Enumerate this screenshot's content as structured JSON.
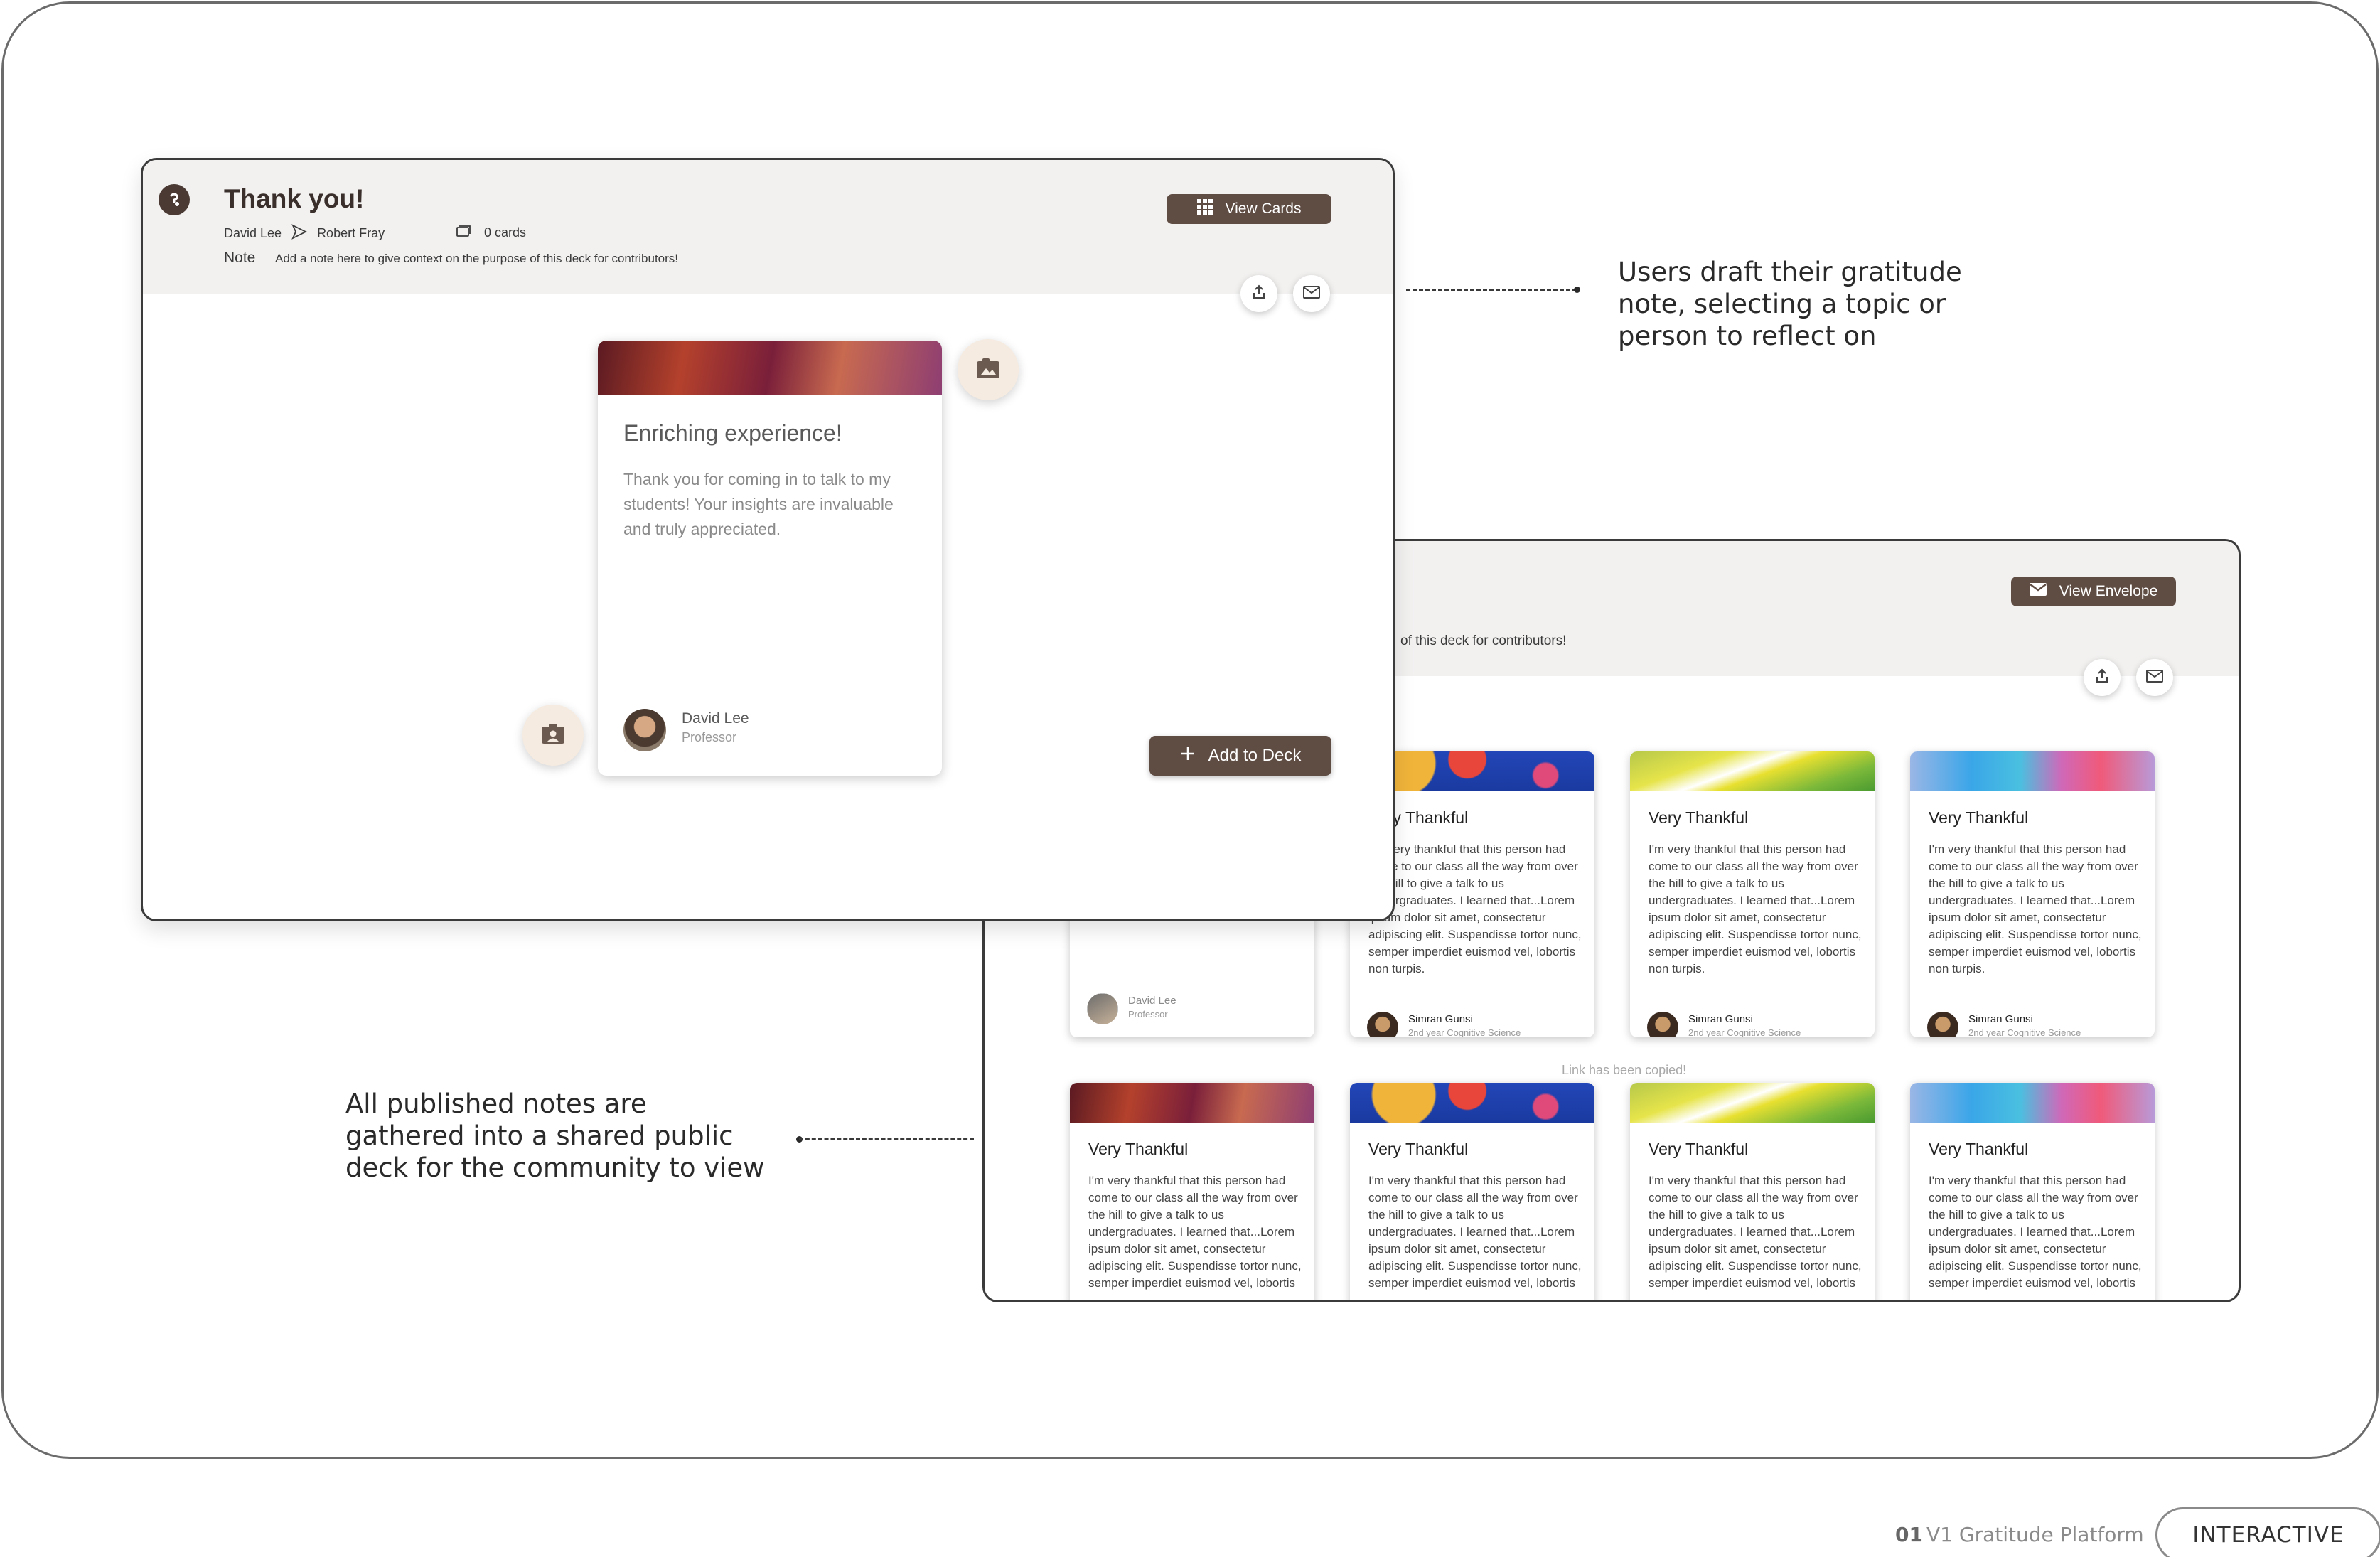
{
  "annotations": {
    "draft": "Users draft their gratitude note, selecting a topic or person to reflect on",
    "deck": "All published notes are gathered into a shared public deck for the community to view"
  },
  "footer": {
    "number": "01",
    "label": "V1 Gratitude Platform",
    "badge": "INTERACTIVE"
  },
  "draft_window": {
    "title": "Thank you!",
    "from": "David Lee",
    "to": "Robert Fray",
    "card_count": "0 cards",
    "note_label": "Note",
    "note_text": "Add a note here to give context on the purpose of this deck for contributors!",
    "view_cards_label": "View Cards",
    "add_to_deck_label": "Add to Deck",
    "card": {
      "title": "Enriching experience!",
      "body": "Thank you for coming in to talk to my students! Your insights are invaluable and truly appreciated.",
      "author": "David Lee",
      "role": "Professor"
    }
  },
  "deck_window": {
    "note_tail": "of this deck for contributors!",
    "view_envelope_label": "View Envelope",
    "link_copied": "Link has been copied!",
    "first_card": {
      "author": "David Lee",
      "role": "Professor"
    },
    "row1": [
      {
        "title": "Very Thankful",
        "body": "I'm very thankful that this person had come to our class all the way from over the hill to give a talk to us undergraduates. I learned that...Lorem ipsum dolor sit amet, consectetur adipiscing elit. Suspendisse tortor nunc, semper imperdiet euismod vel, lobortis non turpis.",
        "author": "Simran Gunsi",
        "role": "2nd year Cognitive Science"
      },
      {
        "title": "Very Thankful",
        "body": "I'm very thankful that this person had come to our class all the way from over the hill to give a talk to us undergraduates. I learned that...Lorem ipsum dolor sit amet, consectetur adipiscing elit. Suspendisse tortor nunc, semper imperdiet euismod vel, lobortis non turpis.",
        "author": "Simran Gunsi",
        "role": "2nd year Cognitive Science"
      },
      {
        "title": "Very Thankful",
        "body": "I'm very thankful that this person had come to our class all the way from over the hill to give a talk to us undergraduates. I learned that...Lorem ipsum dolor sit amet, consectetur adipiscing elit. Suspendisse tortor nunc, semper imperdiet euismod vel, lobortis non turpis.",
        "author": "Simran Gunsi",
        "role": "2nd year Cognitive Science"
      }
    ],
    "row2": [
      {
        "title": "Very Thankful",
        "body": "I'm very thankful that this person had come to our class all the way from over the hill to give a talk to us undergraduates. I learned that...Lorem ipsum dolor sit amet, consectetur adipiscing elit. Suspendisse tortor nunc, semper imperdiet euismod vel, lobortis"
      },
      {
        "title": "Very Thankful",
        "body": "I'm very thankful that this person had come to our class all the way from over the hill to give a talk to us undergraduates. I learned that...Lorem ipsum dolor sit amet, consectetur adipiscing elit. Suspendisse tortor nunc, semper imperdiet euismod vel, lobortis"
      },
      {
        "title": "Very Thankful",
        "body": "I'm very thankful that this person had come to our class all the way from over the hill to give a talk to us undergraduates. I learned that...Lorem ipsum dolor sit amet, consectetur adipiscing elit. Suspendisse tortor nunc, semper imperdiet euismod vel, lobortis"
      },
      {
        "title": "Very Thankful",
        "body": "I'm very thankful that this person had come to our class all the way from over the hill to give a talk to us undergraduates. I learned that...Lorem ipsum dolor sit amet, consectetur adipiscing elit. Suspendisse tortor nunc, semper imperdiet euismod vel, lobortis"
      }
    ]
  },
  "icons": [
    "app-logo-icon",
    "send-arrow-icon",
    "cards-stack-icon",
    "grid-icon",
    "share-icon",
    "mail-icon",
    "image-icon",
    "contact-icon",
    "plus-icon",
    "envelope-icon"
  ],
  "colors": {
    "accent_brown": "#5f4d44",
    "header_bg": "#f2f1f0",
    "bubble_bg": "#f6ebe0"
  }
}
